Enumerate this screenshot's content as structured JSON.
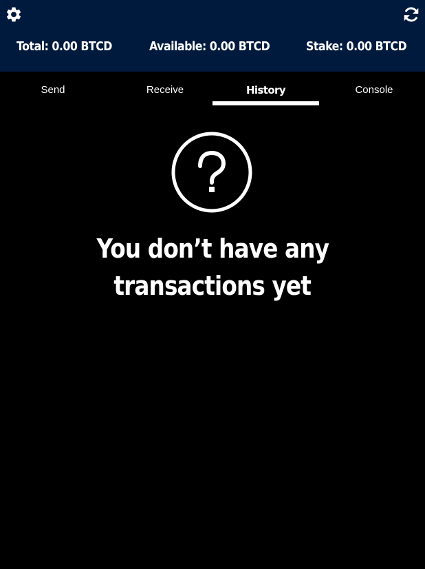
{
  "header": {
    "settings_icon": "gear-icon",
    "refresh_icon": "refresh-icon",
    "background_color": "#001a3e",
    "balances": {
      "total": "Total: 0.00 BTCD",
      "available": "Available: 0.00 BTCD",
      "stake": "Stake: 0.00 BTCD"
    }
  },
  "tabs": [
    {
      "label": "Send",
      "active": false
    },
    {
      "label": "Receive",
      "active": false
    },
    {
      "label": "History",
      "active": true
    },
    {
      "label": "Console",
      "active": false
    }
  ],
  "history": {
    "empty_icon": "question-circle-icon",
    "empty_message_line1": "You don’t have any",
    "empty_message_line2": "transactions yet"
  }
}
